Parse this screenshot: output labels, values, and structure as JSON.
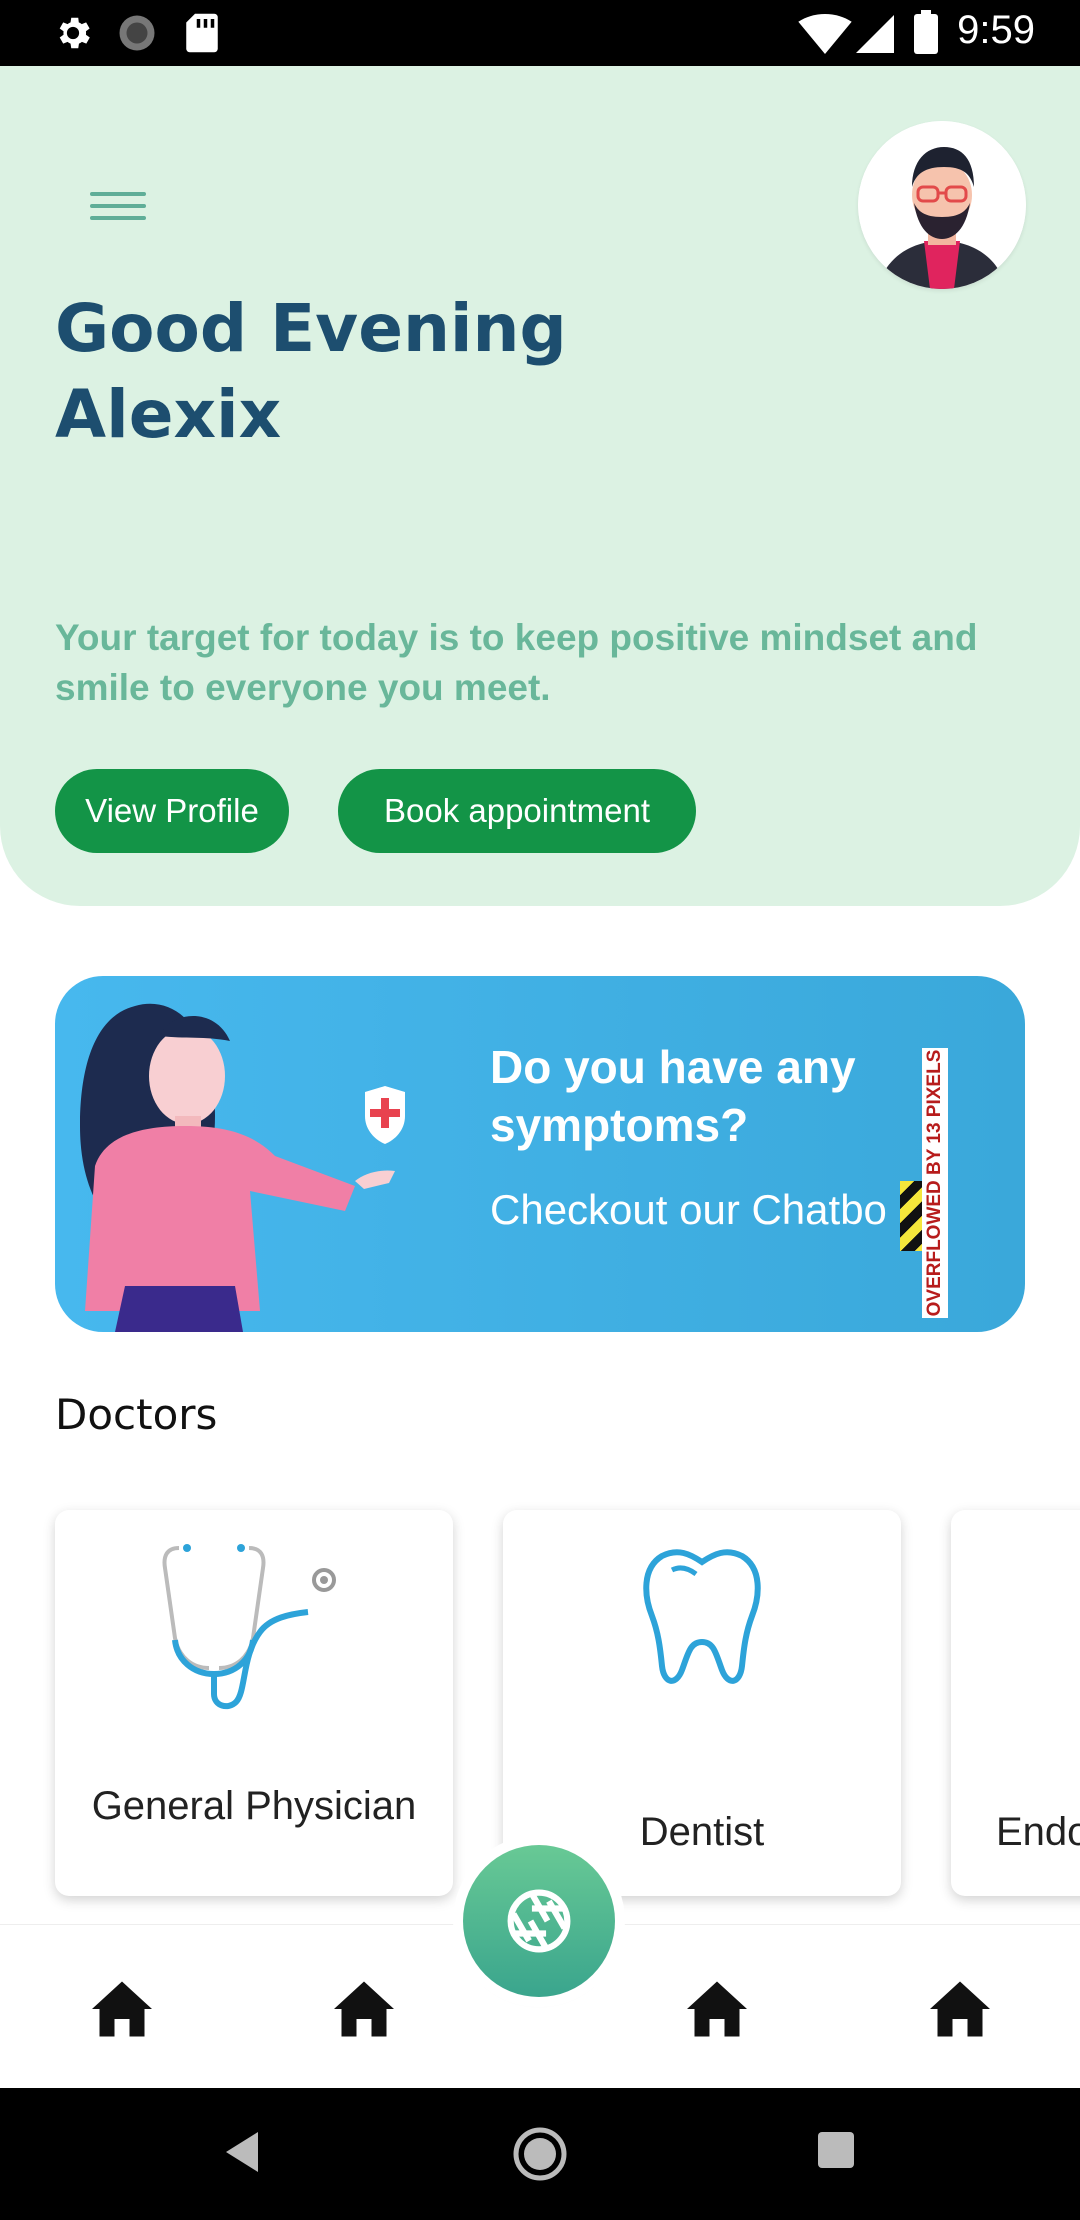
{
  "status_bar": {
    "time": "9:59",
    "icons": [
      "gear-icon",
      "circle-icon",
      "sd-card-icon",
      "wifi-icon",
      "signal-icon",
      "battery-icon"
    ]
  },
  "header": {
    "greeting_line1": "Good Evening",
    "greeting_line2": "Alexix",
    "subtitle": "Your target for today is to keep positive mindset and smile to everyone you meet.",
    "view_profile_label": "View Profile",
    "book_label": "Book appointment",
    "background_color": "#dcf2e3",
    "accent_color": "#139447"
  },
  "promo": {
    "title": "Do you have any symptoms?",
    "cta": "Checkout our Chatbo",
    "overflow_warning": "OVERFLOWED BY 13 PIXELS"
  },
  "doctors": {
    "section_title": "Doctors",
    "items": [
      {
        "label": "General Physician",
        "icon": "stethoscope-icon"
      },
      {
        "label": "Dentist",
        "icon": "tooth-icon"
      },
      {
        "label": "Endo",
        "icon": ""
      }
    ]
  },
  "bottom_nav": {
    "items": [
      "home-icon",
      "home-icon",
      "home-icon",
      "home-icon"
    ],
    "fab_icon": "aperture-icon"
  },
  "system_nav": [
    "back-icon",
    "home-circle-icon",
    "recents-icon"
  ]
}
